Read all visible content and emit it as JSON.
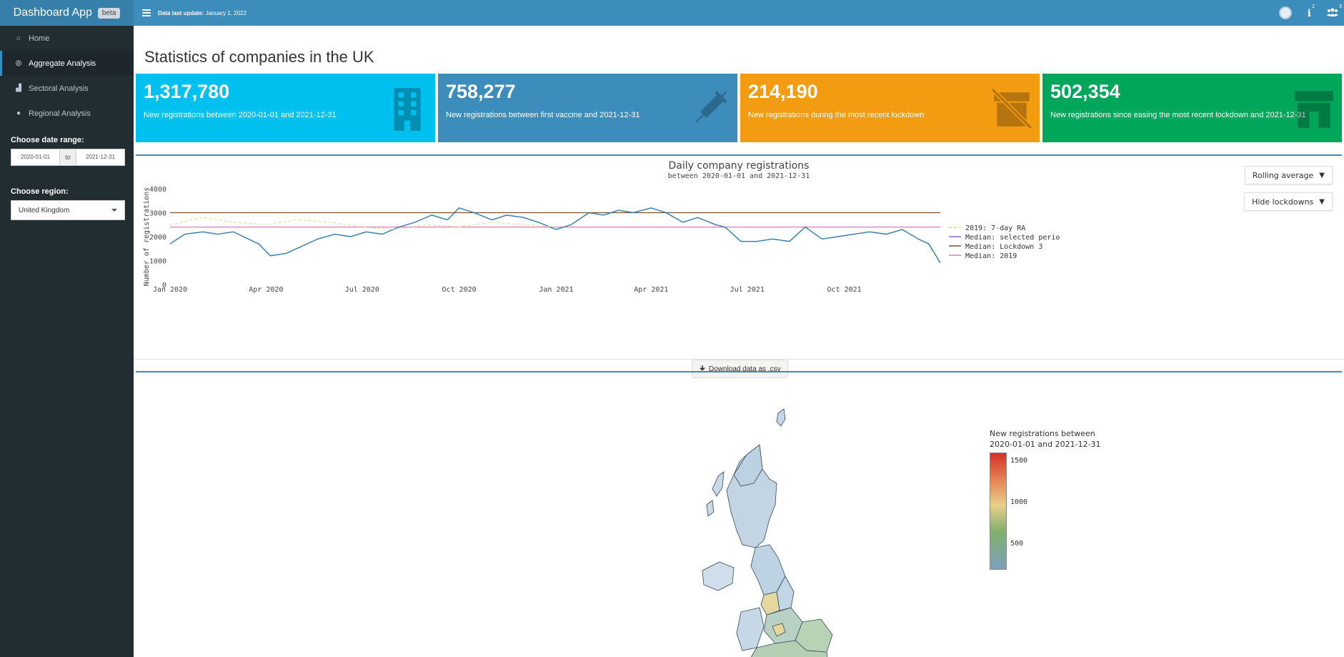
{
  "app": {
    "brand": "Dashboard App",
    "badge": "beta",
    "update_label": "Data last update:",
    "update_date": "January 1, 2022",
    "header_badges": {
      "notifications": "2",
      "users": "3"
    }
  },
  "sidebar": {
    "items": [
      {
        "label": "Home",
        "icon": "home-icon"
      },
      {
        "label": "Aggregate Analysis",
        "icon": "target-icon"
      },
      {
        "label": "Sectoral Analysis",
        "icon": "bar-chart-icon"
      },
      {
        "label": "Regional Analysis",
        "icon": "map-marker-icon"
      }
    ],
    "date_label": "Choose date range:",
    "date_from": "2020-01-01",
    "date_sep": "to",
    "date_to": "2021-12-31",
    "region_label": "Choose region:",
    "region_value": "United Kingdom"
  },
  "main": {
    "title": "Statistics of companies in the UK",
    "boxes": [
      {
        "value": "1,317,780",
        "desc": "New registrations between 2020-01-01 and 2021-12-31",
        "color": "#00c0ef",
        "icon": "building-icon"
      },
      {
        "value": "758,277",
        "desc": "New registrations between first vaccine and 2021-12-31",
        "color": "#3c8dbc",
        "icon": "syringe-icon"
      },
      {
        "value": "214,190",
        "desc": "New registrations during the most recent lockdown",
        "color": "#f39c12",
        "icon": "store-closed-icon"
      },
      {
        "value": "502,354",
        "desc": "New registrations since easing the most recent lockdown and 2021-12-31",
        "color": "#00a65a",
        "icon": "store-icon"
      }
    ],
    "controls": {
      "rolling": "Rolling average",
      "lockdowns": "Hide lockdowns"
    },
    "download_label": "Download data as .csv",
    "map_legend": {
      "title_line1": "New registrations between",
      "title_line2": "2020-01-01 and 2021-12-31",
      "ticks": [
        "1500",
        "1000",
        "500"
      ]
    }
  },
  "chart_data": {
    "type": "line",
    "title": "Daily company registrations",
    "subtitle": "between 2020-01-01 and 2021-12-31",
    "ylabel": "Number of registrations",
    "ylim": [
      0,
      4000
    ],
    "yticks": [
      "0",
      "1000",
      "2000",
      "3000",
      "4000"
    ],
    "xticks": [
      "Jan 2020",
      "Apr 2020",
      "Jul 2020",
      "Oct 2020",
      "Jan 2021",
      "Apr 2021",
      "Jul 2021",
      "Oct 2021"
    ],
    "xrange": [
      "2020-01-01",
      "2021-12-31"
    ],
    "legend": [
      "2019: 7-day RA",
      "Median: selected perio",
      "Median: Lockdown 3",
      "Median: 2019"
    ],
    "series": [
      {
        "name": "Daily registrations",
        "color": "#2f7ab0",
        "x": [
          "2020-01-01",
          "2020-01-15",
          "2020-02-01",
          "2020-02-15",
          "2020-03-01",
          "2020-03-15",
          "2020-03-25",
          "2020-04-05",
          "2020-04-20",
          "2020-05-05",
          "2020-05-20",
          "2020-06-05",
          "2020-06-20",
          "2020-07-05",
          "2020-07-20",
          "2020-08-05",
          "2020-08-20",
          "2020-09-05",
          "2020-09-20",
          "2020-10-01",
          "2020-10-15",
          "2020-11-01",
          "2020-11-15",
          "2020-12-01",
          "2020-12-15",
          "2021-01-01",
          "2021-01-15",
          "2021-02-01",
          "2021-02-15",
          "2021-03-01",
          "2021-03-15",
          "2021-04-01",
          "2021-04-15",
          "2021-05-01",
          "2021-05-15",
          "2021-06-01",
          "2021-06-10",
          "2021-06-25",
          "2021-07-10",
          "2021-07-25",
          "2021-08-10",
          "2021-08-25",
          "2021-09-10",
          "2021-09-25",
          "2021-10-10",
          "2021-10-25",
          "2021-11-10",
          "2021-11-25",
          "2021-12-10",
          "2021-12-20",
          "2021-12-31"
        ],
        "values": [
          1700,
          2100,
          2200,
          2100,
          2200,
          1900,
          1700,
          1200,
          1300,
          1600,
          1900,
          2100,
          2000,
          2200,
          2100,
          2400,
          2600,
          2900,
          2700,
          3200,
          3000,
          2700,
          2900,
          2800,
          2600,
          2300,
          2500,
          3000,
          2900,
          3100,
          3000,
          3200,
          3000,
          2600,
          2800,
          2500,
          2400,
          1800,
          1800,
          1900,
          1800,
          2400,
          1900,
          2000,
          2100,
          2200,
          2100,
          2300,
          1900,
          1700,
          900
        ]
      },
      {
        "name": "2019: 7-day RA",
        "color": "#d9d98a",
        "dashed": true,
        "x": [
          "2020-01-01",
          "2020-02-01",
          "2020-03-01",
          "2020-04-01",
          "2020-05-01",
          "2020-06-01",
          "2020-07-01",
          "2020-08-01",
          "2020-09-01",
          "2020-10-01",
          "2020-11-01",
          "2020-12-01",
          "2021-01-01"
        ],
        "values": [
          2500,
          2800,
          2600,
          2500,
          2700,
          2600,
          2400,
          2300,
          2500,
          2400,
          2600,
          2500,
          2400
        ]
      }
    ],
    "hlines": [
      {
        "name": "Median: Lockdown 3",
        "value": 3000,
        "color": "#7a5230"
      },
      {
        "name": "Median: 2019",
        "value": 2400,
        "color": "#e377c2"
      }
    ]
  }
}
